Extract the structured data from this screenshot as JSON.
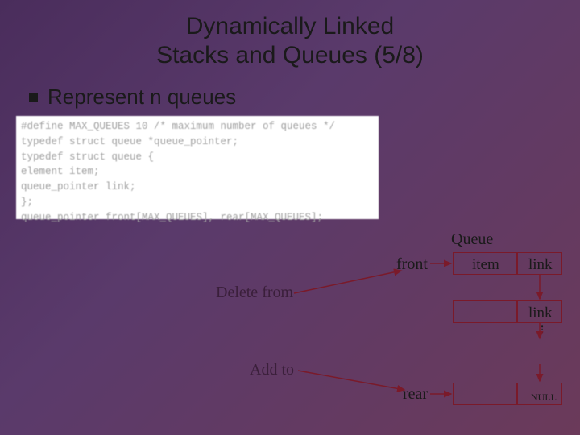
{
  "title_line1": "Dynamically Linked",
  "title_line2": "Stacks and Queues (5/8)",
  "bullet": "Represent n queues",
  "code": {
    "l1": "#define MAX_QUEUES 10 /* maximum number of queues */",
    "l2": "typedef struct queue *queue_pointer;",
    "l3": "typedef struct queue {",
    "l4": "        element item;",
    "l5": "        queue_pointer link;",
    "l6": "        };",
    "l7": "queue_pointer front[MAX_QUEUES], rear[MAX_QUEUES];"
  },
  "diagram": {
    "queue": "Queue",
    "front": "front",
    "item": "item",
    "link": "link",
    "delete": "Delete from",
    "add": "Add to",
    "rear": "rear",
    "null": "NULL",
    "dots": "..."
  }
}
